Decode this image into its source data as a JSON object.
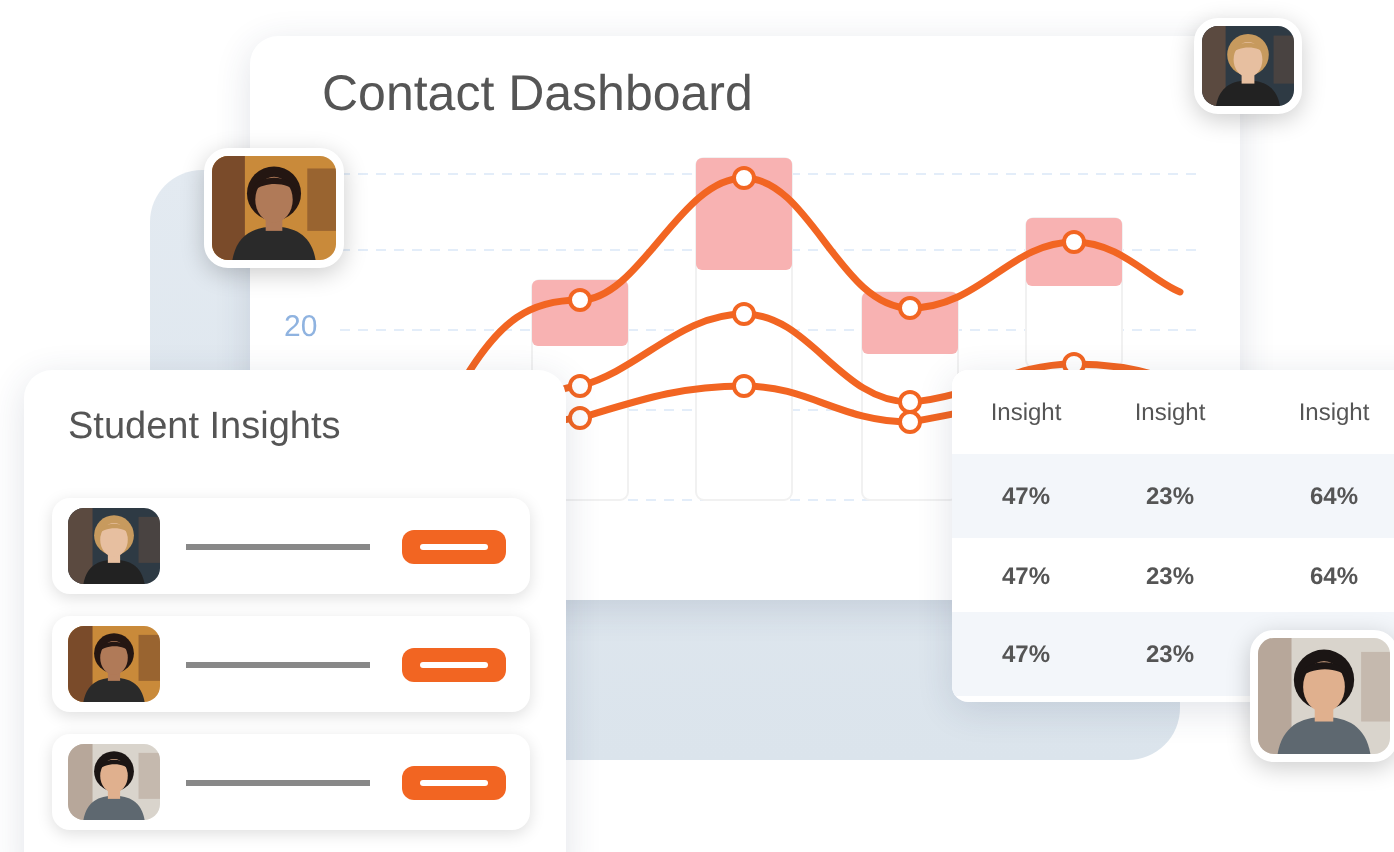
{
  "dashboard": {
    "title": "Contact Dashboard",
    "axis_label": "20"
  },
  "student_insights": {
    "title": "Student Insights"
  },
  "table": {
    "columns": [
      "Insight",
      "Insight",
      "Insight"
    ],
    "rows": [
      [
        "47%",
        "23%",
        "64%"
      ],
      [
        "47%",
        "23%",
        "64%"
      ],
      [
        "47%",
        "23%"
      ]
    ]
  }
}
